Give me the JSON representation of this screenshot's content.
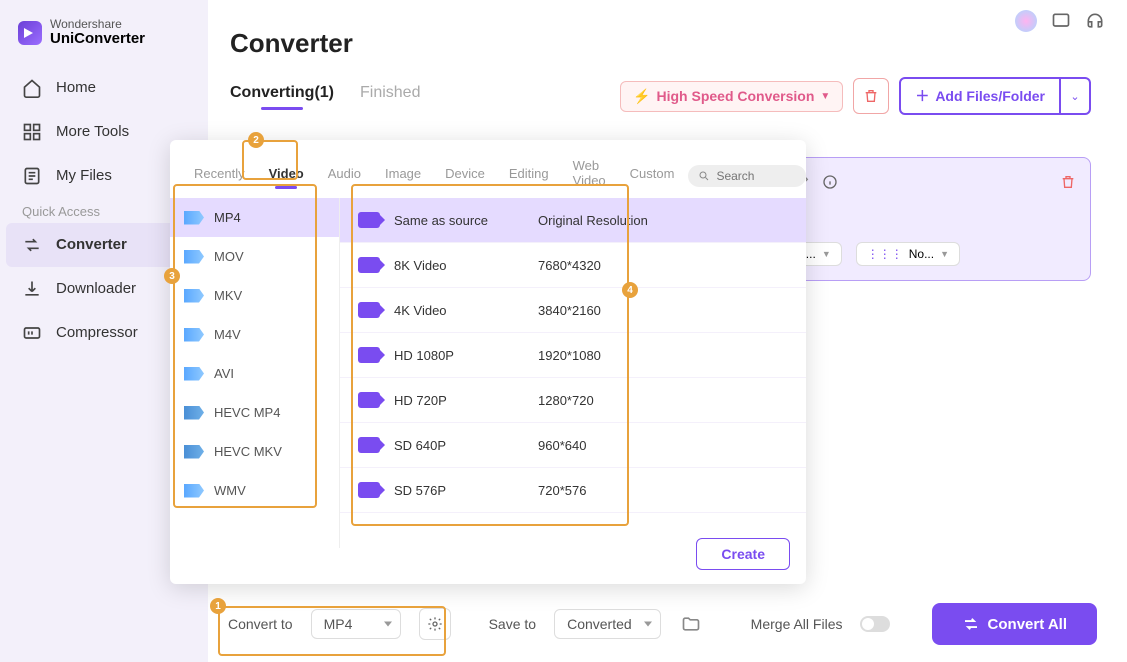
{
  "brand": {
    "line1": "Wondershare",
    "line2": "UniConverter"
  },
  "sidebar": {
    "items": [
      {
        "label": "Home"
      },
      {
        "label": "More Tools"
      },
      {
        "label": "My Files"
      }
    ],
    "quick_label": "Quick Access",
    "quick": [
      {
        "label": "Converter"
      },
      {
        "label": "Downloader"
      },
      {
        "label": "Compressor"
      }
    ]
  },
  "page_title": "Converter",
  "main_tabs": {
    "converting": "Converting(1)",
    "finished": "Finished"
  },
  "actions": {
    "high_speed": "High Speed Conversion",
    "add_files": "Add Files/Folder"
  },
  "file_card": {
    "opt1": "o S...",
    "opt2": "No..."
  },
  "popup": {
    "tabs": [
      "Recently",
      "Video",
      "Audio",
      "Image",
      "Device",
      "Editing",
      "Web Video",
      "Custom"
    ],
    "search_placeholder": "Search",
    "formats": [
      "MP4",
      "MOV",
      "MKV",
      "M4V",
      "AVI",
      "HEVC MP4",
      "HEVC MKV",
      "WMV"
    ],
    "resolutions": [
      {
        "name": "Same as source",
        "value": "Original Resolution"
      },
      {
        "name": "8K Video",
        "value": "7680*4320"
      },
      {
        "name": "4K Video",
        "value": "3840*2160"
      },
      {
        "name": "HD 1080P",
        "value": "1920*1080"
      },
      {
        "name": "HD 720P",
        "value": "1280*720"
      },
      {
        "name": "SD 640P",
        "value": "960*640"
      },
      {
        "name": "SD 576P",
        "value": "720*576"
      }
    ],
    "create": "Create"
  },
  "bottom": {
    "convert_to_label": "Convert to",
    "convert_to_value": "MP4",
    "save_to_label": "Save to",
    "save_to_value": "Converted",
    "merge_label": "Merge All Files",
    "convert_all": "Convert All"
  },
  "annotations": {
    "1": "1",
    "2": "2",
    "3": "3",
    "4": "4"
  }
}
